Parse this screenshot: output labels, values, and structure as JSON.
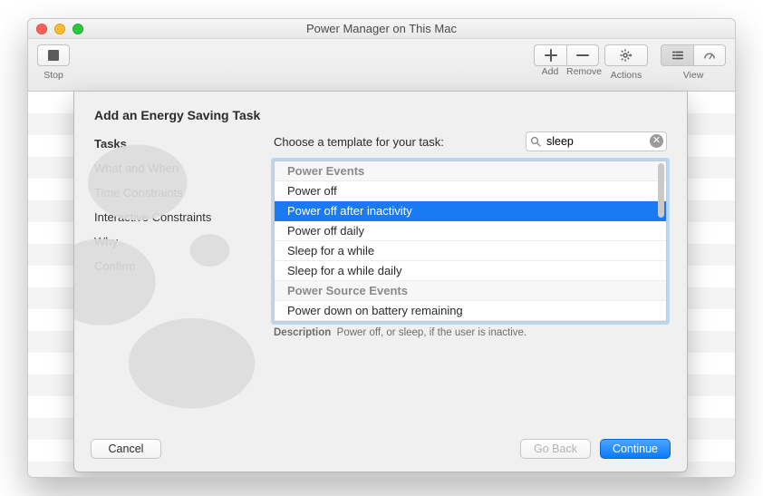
{
  "window": {
    "title": "Power Manager on This Mac"
  },
  "toolbar": {
    "stop_label": "Stop",
    "add_label": "Add",
    "remove_label": "Remove",
    "actions_label": "Actions",
    "view_label": "View"
  },
  "sheet": {
    "header": "Add an Energy Saving Task",
    "steps": [
      "Tasks",
      "What and When",
      "Time Constraints",
      "Interactive Constraints",
      "Why",
      "Confirm"
    ],
    "current_step_index": 0,
    "choose_label": "Choose a template for your task:",
    "search_value": "sleep",
    "list": [
      {
        "label": "Power Events",
        "header": true
      },
      {
        "label": "Power off"
      },
      {
        "label": "Power off after inactivity",
        "selected": true
      },
      {
        "label": "Power off daily"
      },
      {
        "label": "Sleep for a while"
      },
      {
        "label": "Sleep for a while daily"
      },
      {
        "label": "Power Source Events",
        "header": true
      },
      {
        "label": "Power down on battery remaining"
      }
    ],
    "description_label": "Description",
    "description_text": "Power off, or sleep, if the user is inactive.",
    "cancel_label": "Cancel",
    "goback_label": "Go Back",
    "continue_label": "Continue"
  }
}
